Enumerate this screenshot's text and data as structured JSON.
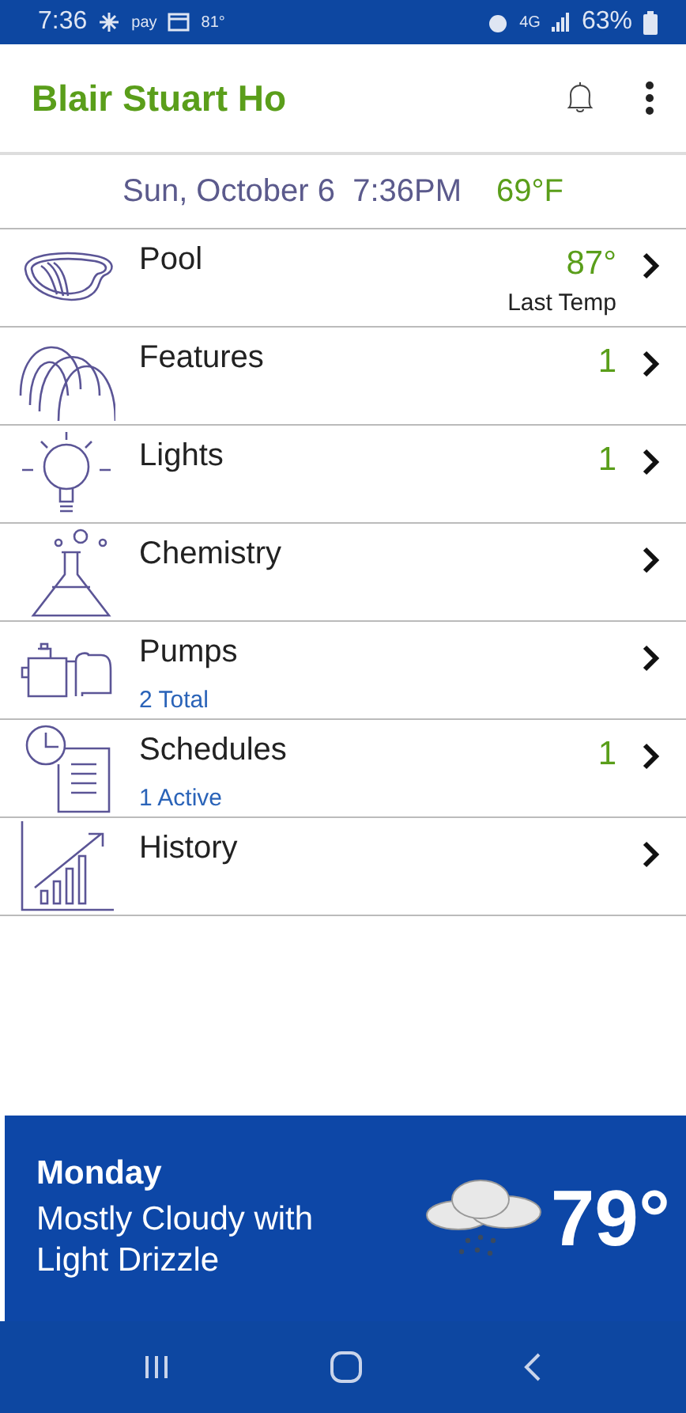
{
  "status_bar": {
    "time": "7:36",
    "pay": "pay",
    "temperature": "81°",
    "network": "4G",
    "battery": "63%"
  },
  "header": {
    "title": "Blair Stuart Ho"
  },
  "date_bar": {
    "datetime": "Sun, October 6  7:36PM",
    "temperature": "69°F"
  },
  "menu": [
    {
      "label": "Pool",
      "value": "87°",
      "caption": "Last Temp"
    },
    {
      "label": "Features",
      "value": "1"
    },
    {
      "label": "Lights",
      "value": "1"
    },
    {
      "label": "Chemistry"
    },
    {
      "label": "Pumps",
      "subtitle": "2 Total"
    },
    {
      "label": "Schedules",
      "value": "1",
      "subtitle": "1 Active"
    },
    {
      "label": "History"
    }
  ],
  "weather": {
    "day": "Monday",
    "condition": "Mostly Cloudy with Light Drizzle",
    "temperature": "79°"
  }
}
